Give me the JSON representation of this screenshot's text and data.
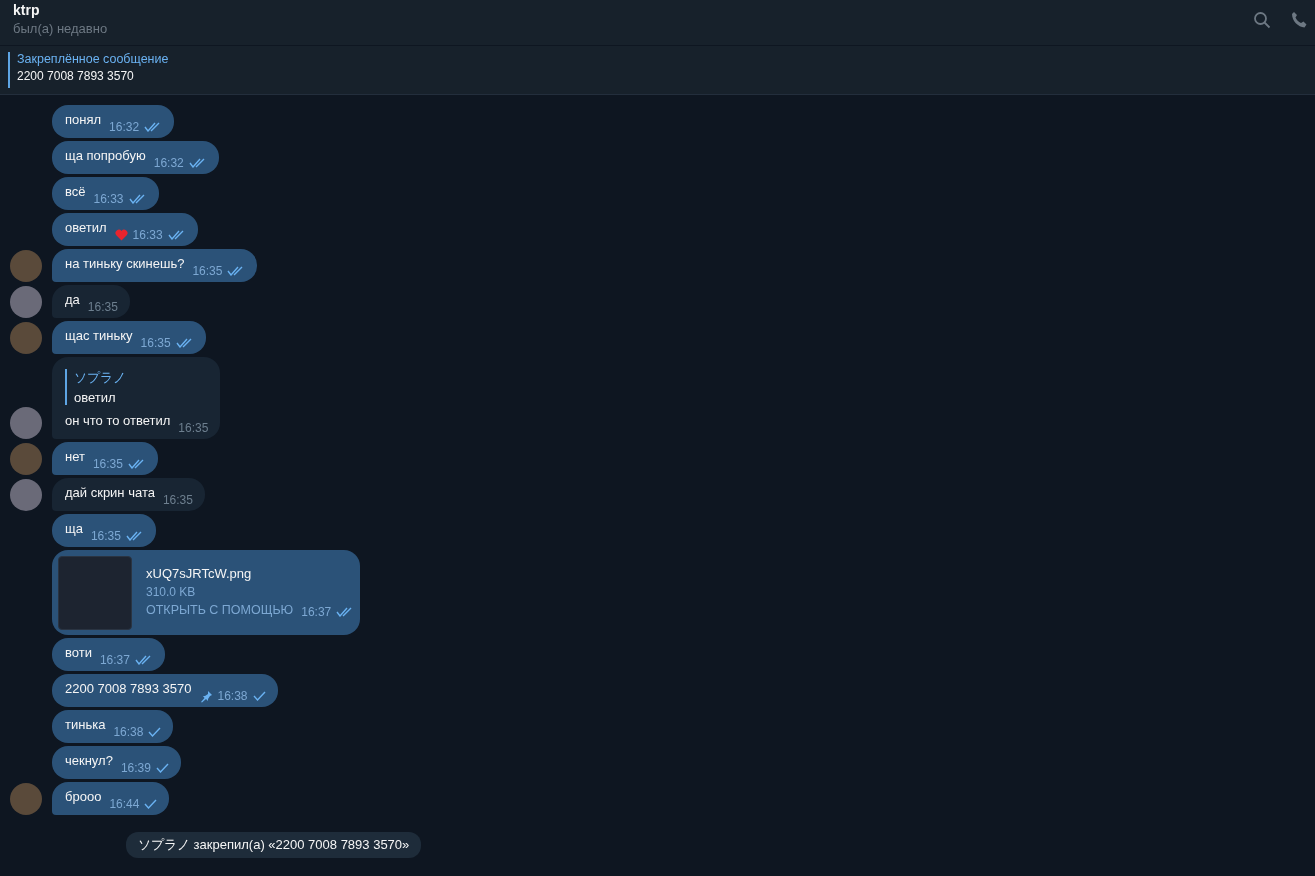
{
  "header": {
    "title": "ktrp",
    "status": "был(а) недавно"
  },
  "pinned": {
    "label": "Закреплённое сообщение",
    "text": "2200 7008 7893 3570"
  },
  "messages": [
    {
      "kind": "text",
      "outgoing": true,
      "avatar": false,
      "text": "понял",
      "time": "16:32",
      "read": true
    },
    {
      "kind": "text",
      "outgoing": true,
      "avatar": false,
      "text": "ща попробую",
      "time": "16:32",
      "read": true
    },
    {
      "kind": "text",
      "outgoing": true,
      "avatar": false,
      "text": "всё",
      "time": "16:33",
      "read": true
    },
    {
      "kind": "text",
      "outgoing": true,
      "avatar": false,
      "text": "оветил",
      "time": "16:33",
      "read": true,
      "reaction": true
    },
    {
      "kind": "text",
      "outgoing": true,
      "avatar": true,
      "text": "на тиньку скинешь?",
      "time": "16:35",
      "read": true
    },
    {
      "kind": "text",
      "outgoing": false,
      "avatar": true,
      "text": "да",
      "time": "16:35"
    },
    {
      "kind": "text",
      "outgoing": true,
      "avatar": true,
      "text": "щас тиньку",
      "time": "16:35",
      "read": true
    },
    {
      "kind": "reply",
      "outgoing": false,
      "avatar": true,
      "reply_name": "ソプラノ",
      "reply_text": "оветил",
      "text": "он что то ответил",
      "time": "16:35"
    },
    {
      "kind": "text",
      "outgoing": true,
      "avatar": true,
      "text": "нет",
      "time": "16:35",
      "read": true
    },
    {
      "kind": "text",
      "outgoing": false,
      "avatar": true,
      "text": "дай скрин чата",
      "time": "16:35"
    },
    {
      "kind": "text",
      "outgoing": true,
      "avatar": false,
      "text": "ща",
      "time": "16:35",
      "read": true
    },
    {
      "kind": "file",
      "outgoing": true,
      "avatar": false,
      "file_name": "xUQ7sJRTcW.png",
      "size": "310.0 KB",
      "action": "ОТКРЫТЬ С ПОМОЩЬЮ",
      "time": "16:37",
      "read": true
    },
    {
      "kind": "text",
      "outgoing": true,
      "avatar": false,
      "text": "воти",
      "time": "16:37",
      "read": true
    },
    {
      "kind": "text",
      "outgoing": true,
      "avatar": false,
      "text": "2200 7008 7893 3570",
      "time": "16:38",
      "read": false,
      "pinned": true
    },
    {
      "kind": "text",
      "outgoing": true,
      "avatar": false,
      "text": "тинька",
      "time": "16:38",
      "read": false
    },
    {
      "kind": "text",
      "outgoing": true,
      "avatar": false,
      "text": "чекнул?",
      "time": "16:39",
      "read": false
    },
    {
      "kind": "text",
      "outgoing": true,
      "avatar": true,
      "text": "брооо",
      "time": "16:44",
      "read": false
    }
  ],
  "service_message": "ソプラノ закрепил(а) «2200 7008 7893 3570»"
}
